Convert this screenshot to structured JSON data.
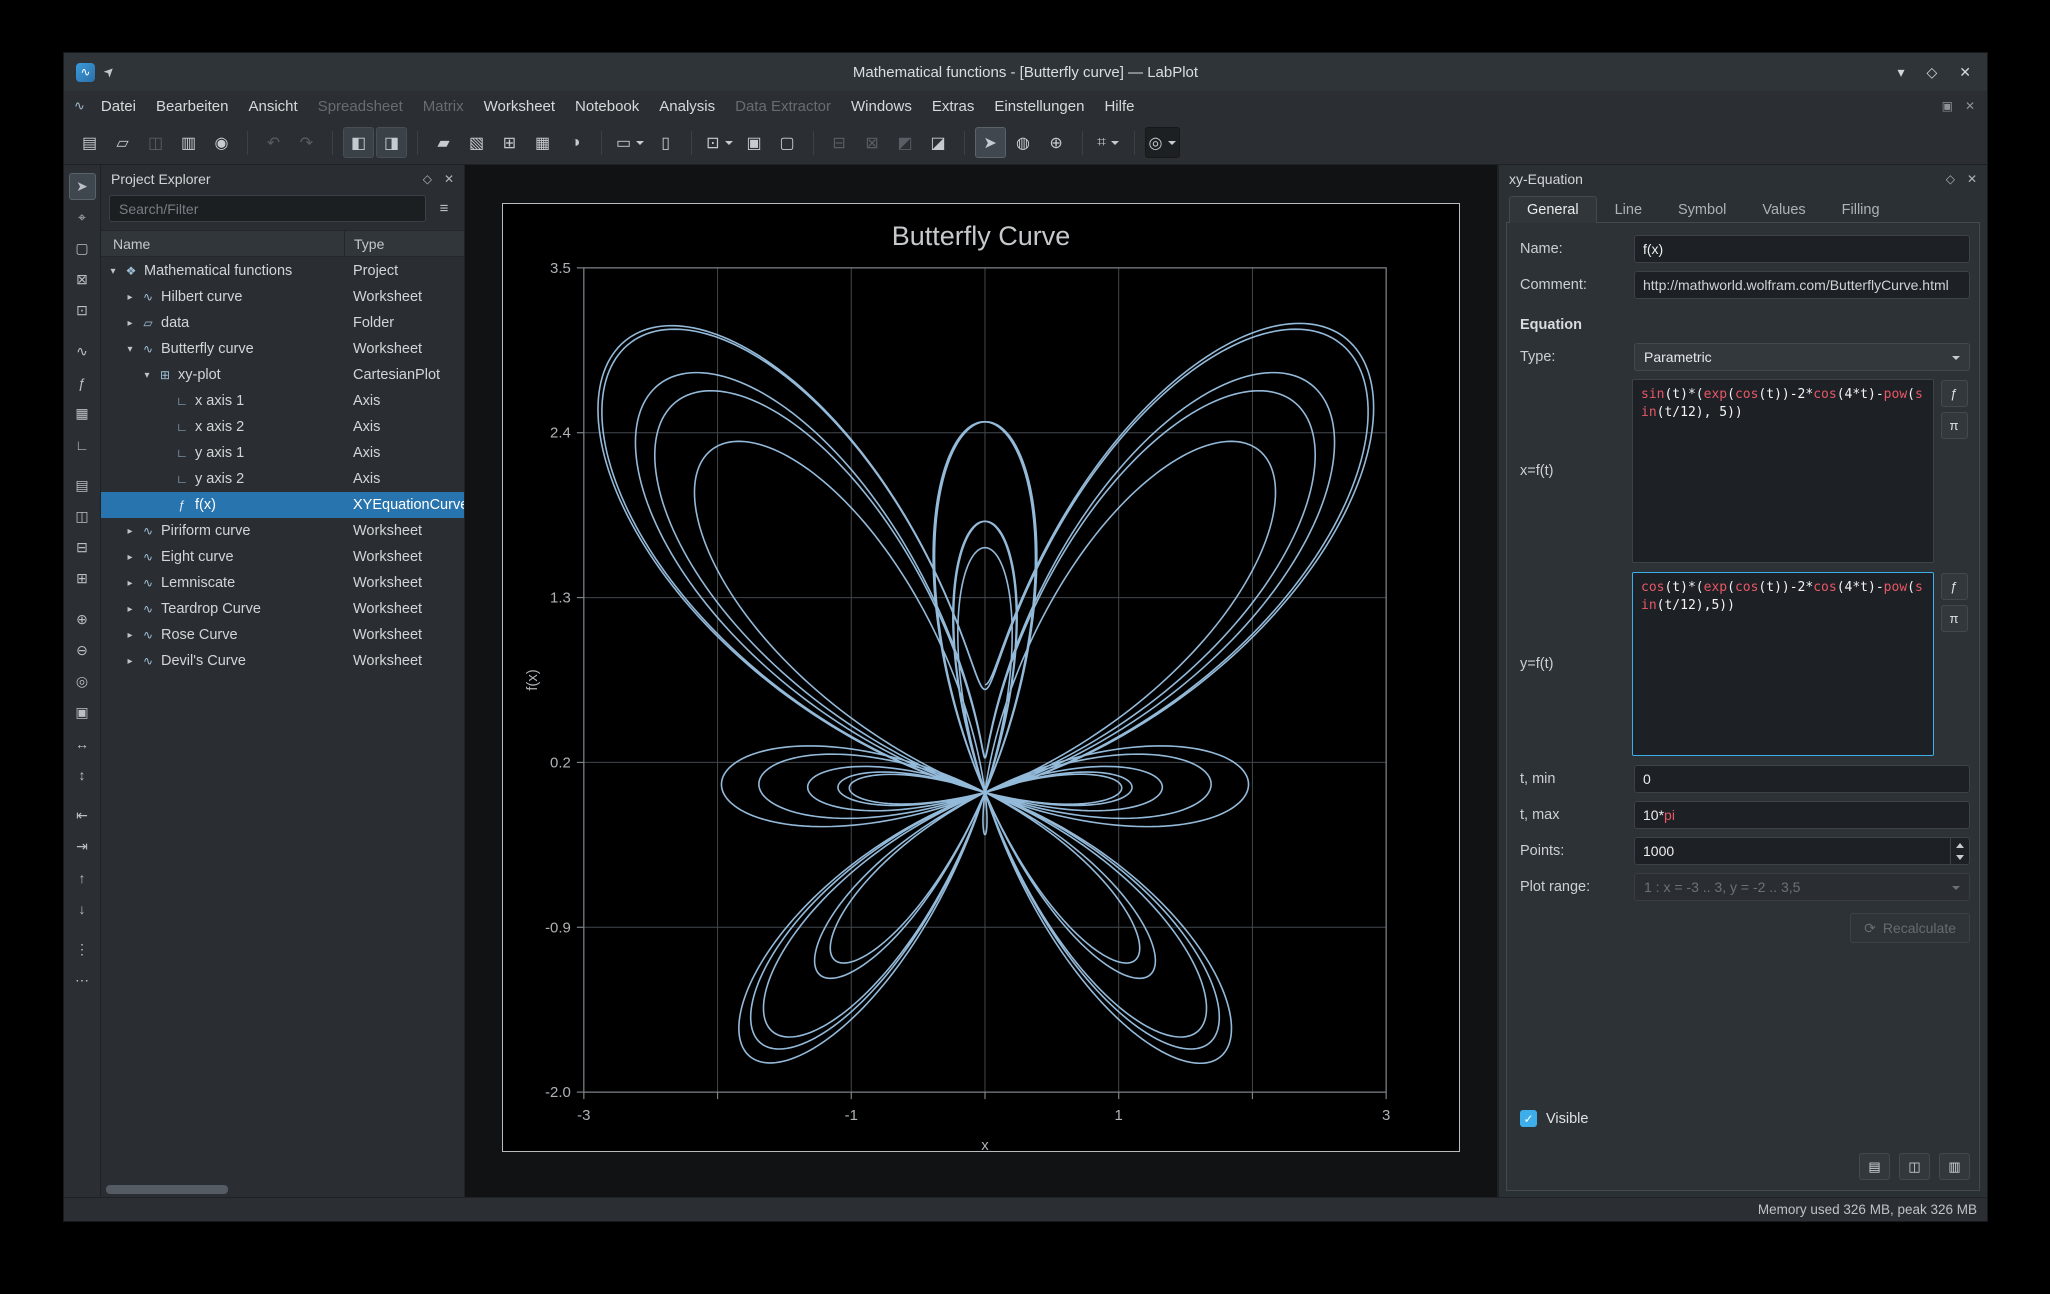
{
  "colors": {
    "accent": "#3daee9",
    "selection": "#2874ae",
    "keyword": "#e85766",
    "curve": "#9cc4e6"
  },
  "titlebar": {
    "title": "Mathematical functions - [Butterfly curve] — LabPlot",
    "app_icon_glyph": "∿",
    "pin_icon": "➤",
    "shade_icon": "▾",
    "maximize_icon": "◇",
    "close_icon": "✕"
  },
  "menubar": {
    "window_icon": "∿",
    "items": [
      {
        "label": "Datei",
        "enabled": true
      },
      {
        "label": "Bearbeiten",
        "enabled": true
      },
      {
        "label": "Ansicht",
        "enabled": true
      },
      {
        "label": "Spreadsheet",
        "enabled": false
      },
      {
        "label": "Matrix",
        "enabled": false
      },
      {
        "label": "Worksheet",
        "enabled": true
      },
      {
        "label": "Notebook",
        "enabled": true
      },
      {
        "label": "Analysis",
        "enabled": true
      },
      {
        "label": "Data Extractor",
        "enabled": false
      },
      {
        "label": "Windows",
        "enabled": true
      },
      {
        "label": "Extras",
        "enabled": true
      },
      {
        "label": "Einstellungen",
        "enabled": true
      },
      {
        "label": "Hilfe",
        "enabled": true
      }
    ],
    "right_icons": [
      {
        "name": "restore-child-icon",
        "glyph": "▣"
      },
      {
        "name": "close-child-icon",
        "glyph": "✕"
      }
    ]
  },
  "toolbar": {
    "items": [
      {
        "name": "new-project-button",
        "glyph": "▤"
      },
      {
        "name": "open-project-button",
        "glyph": "▱"
      },
      {
        "name": "save-project-button",
        "glyph": "◫",
        "disabled": true
      },
      {
        "name": "print-button",
        "glyph": "▥"
      },
      {
        "name": "print-preview-button",
        "glyph": "◉"
      },
      {
        "sep": true
      },
      {
        "name": "undo-button",
        "glyph": "↶",
        "disabled": true
      },
      {
        "name": "redo-button",
        "glyph": "↷",
        "disabled": true
      },
      {
        "sep": true
      },
      {
        "name": "toggle-project-explorer-button",
        "glyph": "◧",
        "checked": true
      },
      {
        "name": "toggle-properties-button",
        "glyph": "◨",
        "checked": true
      },
      {
        "sep": true
      },
      {
        "name": "new-folder-button",
        "glyph": "▰"
      },
      {
        "name": "new-workbook-button",
        "glyph": "▧"
      },
      {
        "name": "new-spreadsheet-button",
        "glyph": "⊞"
      },
      {
        "name": "new-matrix-button",
        "glyph": "▦"
      },
      {
        "name": "color-settings-button",
        "glyph": "◑"
      },
      {
        "sep": true
      },
      {
        "name": "new-worksheet-button",
        "glyph": "▭",
        "chev": true
      },
      {
        "name": "new-notebook-button",
        "glyph": "▯"
      },
      {
        "sep": true
      },
      {
        "name": "zoom-mode-button",
        "glyph": "⊡",
        "chev": true
      },
      {
        "name": "fit-page-button",
        "glyph": "▣"
      },
      {
        "name": "fit-width-button",
        "glyph": "▢"
      },
      {
        "sep": true
      },
      {
        "name": "add-plot-button",
        "glyph": "⊟",
        "disabled": true
      },
      {
        "name": "remove-plot-button",
        "glyph": "⊠",
        "disabled": true
      },
      {
        "name": "layout-button",
        "glyph": "◩",
        "disabled": true
      },
      {
        "name": "break-layout-button",
        "glyph": "◪"
      },
      {
        "sep": true
      },
      {
        "name": "select-mode-button",
        "glyph": "➤",
        "active": true
      },
      {
        "name": "crosshair-mode-button",
        "glyph": "◍"
      },
      {
        "name": "zoom-fit-button",
        "glyph": "⊕"
      },
      {
        "sep": true
      },
      {
        "name": "snap-grid-button",
        "glyph": "⌗",
        "chev": true
      },
      {
        "sep": true
      },
      {
        "name": "magnifier-button",
        "glyph": "◎",
        "chev": true,
        "pressed": true
      }
    ]
  },
  "left_toolbar": {
    "items": [
      {
        "name": "select-tool",
        "glyph": "➤",
        "active": true
      },
      {
        "name": "crosshair-tool",
        "glyph": "⌖"
      },
      {
        "name": "zoom-select-tool",
        "glyph": "▢"
      },
      {
        "name": "zoom-x-select-tool",
        "glyph": "⊠"
      },
      {
        "name": "zoom-y-select-tool",
        "glyph": "⊡"
      },
      {
        "gap": true
      },
      {
        "name": "add-curve-tool",
        "glyph": "∿"
      },
      {
        "name": "add-equation-curve-tool",
        "glyph": "ƒ"
      },
      {
        "name": "add-histogram-tool",
        "glyph": "▦"
      },
      {
        "name": "add-axis-tool",
        "glyph": "∟"
      },
      {
        "gap": true
      },
      {
        "name": "add-legend-tool",
        "glyph": "▤"
      },
      {
        "name": "horizontal-layout-tool",
        "glyph": "◫"
      },
      {
        "name": "vertical-layout-tool",
        "glyph": "⊟"
      },
      {
        "name": "grid-layout-tool",
        "glyph": "⊞"
      },
      {
        "gap": true
      },
      {
        "name": "zoom-in-tool",
        "glyph": "⊕"
      },
      {
        "name": "zoom-out-tool",
        "glyph": "⊖"
      },
      {
        "name": "zoom-origin-tool",
        "glyph": "◎"
      },
      {
        "name": "zoom-fit-page-tool",
        "glyph": "▣"
      },
      {
        "name": "zoom-fit-width-tool",
        "glyph": "↔"
      },
      {
        "name": "zoom-fit-height-tool",
        "glyph": "↕"
      },
      {
        "gap": true
      },
      {
        "name": "shift-left-x-tool",
        "glyph": "⇤"
      },
      {
        "name": "shift-right-x-tool",
        "glyph": "⇥"
      },
      {
        "name": "shift-up-y-tool",
        "glyph": "↑"
      },
      {
        "name": "shift-down-y-tool",
        "glyph": "↓"
      },
      {
        "gap": true
      },
      {
        "name": "more-tools-button",
        "glyph": "⋮"
      },
      {
        "name": "overflow-tools-button",
        "glyph": "⋯"
      }
    ]
  },
  "project_explorer": {
    "title": "Project Explorer",
    "float_icon": "◇",
    "close_icon": "✕",
    "search_placeholder": "Search/Filter",
    "filter_icon": "≡",
    "columns": [
      "Name",
      "Type"
    ],
    "type_icons": {
      "project": "❖",
      "worksheet": "∿",
      "folder": "▱",
      "plot": "⊞",
      "axis": "∟",
      "curve": "ƒ"
    },
    "rows": [
      {
        "name": "Mathematical functions",
        "type": "Project",
        "indent": 0,
        "expander": "open",
        "icon": "project"
      },
      {
        "name": "Hilbert curve",
        "type": "Worksheet",
        "indent": 1,
        "expander": "closed",
        "icon": "worksheet"
      },
      {
        "name": "data",
        "type": "Folder",
        "indent": 1,
        "expander": "closed",
        "icon": "folder"
      },
      {
        "name": "Butterfly curve",
        "type": "Worksheet",
        "indent": 1,
        "expander": "open",
        "icon": "worksheet"
      },
      {
        "name": "xy-plot",
        "type": "CartesianPlot",
        "indent": 2,
        "expander": "open",
        "icon": "plot"
      },
      {
        "name": "x axis 1",
        "type": "Axis",
        "indent": 3,
        "expander": "none",
        "icon": "axis"
      },
      {
        "name": "x axis 2",
        "type": "Axis",
        "indent": 3,
        "expander": "none",
        "icon": "axis"
      },
      {
        "name": "y axis 1",
        "type": "Axis",
        "indent": 3,
        "expander": "none",
        "icon": "axis"
      },
      {
        "name": "y axis 2",
        "type": "Axis",
        "indent": 3,
        "expander": "none",
        "icon": "axis"
      },
      {
        "name": "f(x)",
        "type": "XYEquationCurve",
        "indent": 3,
        "expander": "none",
        "icon": "curve",
        "selected": true
      },
      {
        "name": "Piriform curve",
        "type": "Worksheet",
        "indent": 1,
        "expander": "closed",
        "icon": "worksheet"
      },
      {
        "name": "Eight curve",
        "type": "Worksheet",
        "indent": 1,
        "expander": "closed",
        "icon": "worksheet"
      },
      {
        "name": "Lemniscate",
        "type": "Worksheet",
        "indent": 1,
        "expander": "closed",
        "icon": "worksheet"
      },
      {
        "name": "Teardrop Curve",
        "type": "Worksheet",
        "indent": 1,
        "expander": "closed",
        "icon": "worksheet"
      },
      {
        "name": "Rose Curve",
        "type": "Worksheet",
        "indent": 1,
        "expander": "closed",
        "icon": "worksheet"
      },
      {
        "name": "Devil's Curve",
        "type": "Worksheet",
        "indent": 1,
        "expander": "closed",
        "icon": "worksheet"
      }
    ]
  },
  "dock": {
    "title": "xy-Equation",
    "float_icon": "◇",
    "close_icon": "✕",
    "tabs": [
      "General",
      "Line",
      "Symbol",
      "Values",
      "Filling"
    ],
    "active_tab": "General",
    "name_label": "Name:",
    "name_value": "f(x)",
    "comment_label": "Comment:",
    "comment_value": "http://mathworld.wolfram.com/ButterflyCurve.html",
    "equation_section": "Equation",
    "type_label": "Type:",
    "type_value": "Parametric",
    "x_label": "x=f(t)",
    "x_value": "sin(t)*(exp(cos(t))-2*cos(4*t)-pow(sin(t/12), 5))",
    "y_label": "y=f(t)",
    "y_value": "cos(t)*(exp(cos(t))-2*cos(4*t)-pow(sin(t/12),5))",
    "insert_function_icon": "ƒ",
    "insert_constant_icon": "π",
    "tmin_label": "t, min",
    "tmin_value": "0",
    "tmax_label": "t, max",
    "tmax_value": "10*pi",
    "points_label": "Points:",
    "points_value": "1000",
    "plot_range_label": "Plot range:",
    "plot_range_value": "1 : x = -3 .. 3, y = -2 .. 3,5",
    "recalculate_icon": "⟳",
    "recalculate_label": "Recalculate",
    "check_icon": "✓",
    "visible_label": "Visible",
    "bottom_buttons": [
      {
        "name": "load-function-button",
        "glyph": "▤"
      },
      {
        "name": "save-function-button",
        "glyph": "◫"
      },
      {
        "name": "save-as-function-button",
        "glyph": "▥"
      }
    ]
  },
  "statusbar": {
    "memory": "Memory used 326 MB, peak 326 MB"
  },
  "chart_data": {
    "type": "line",
    "title": "Butterfly Curve",
    "xlabel": "x",
    "ylabel": "f(x)",
    "xlim": [
      -3,
      3
    ],
    "ylim": [
      -2,
      3.5
    ],
    "x_tick_labels": [
      -3,
      -1,
      1,
      3
    ],
    "x_gridlines": [
      -3,
      -2,
      -1,
      0,
      1,
      2,
      3
    ],
    "y_tick_labels": [
      3.5,
      2.4,
      1.3,
      0.2,
      -0.9,
      -2.0
    ],
    "y_gridlines": [
      3.5,
      2.4,
      1.3,
      0.2,
      -0.9,
      -2.0
    ],
    "grid": true,
    "legend": "none",
    "series": [
      {
        "name": "f(x)",
        "kind": "parametric",
        "x_equation": "sin(t)*(exp(cos(t))-2*cos(4*t)-pow(sin(t/12), 5))",
        "y_equation": "cos(t)*(exp(cos(t))-2*cos(4*t)-pow(sin(t/12),5))",
        "t_min": 0,
        "t_max": "10*pi",
        "points": 1000,
        "color": "#9cc4e6"
      }
    ]
  }
}
